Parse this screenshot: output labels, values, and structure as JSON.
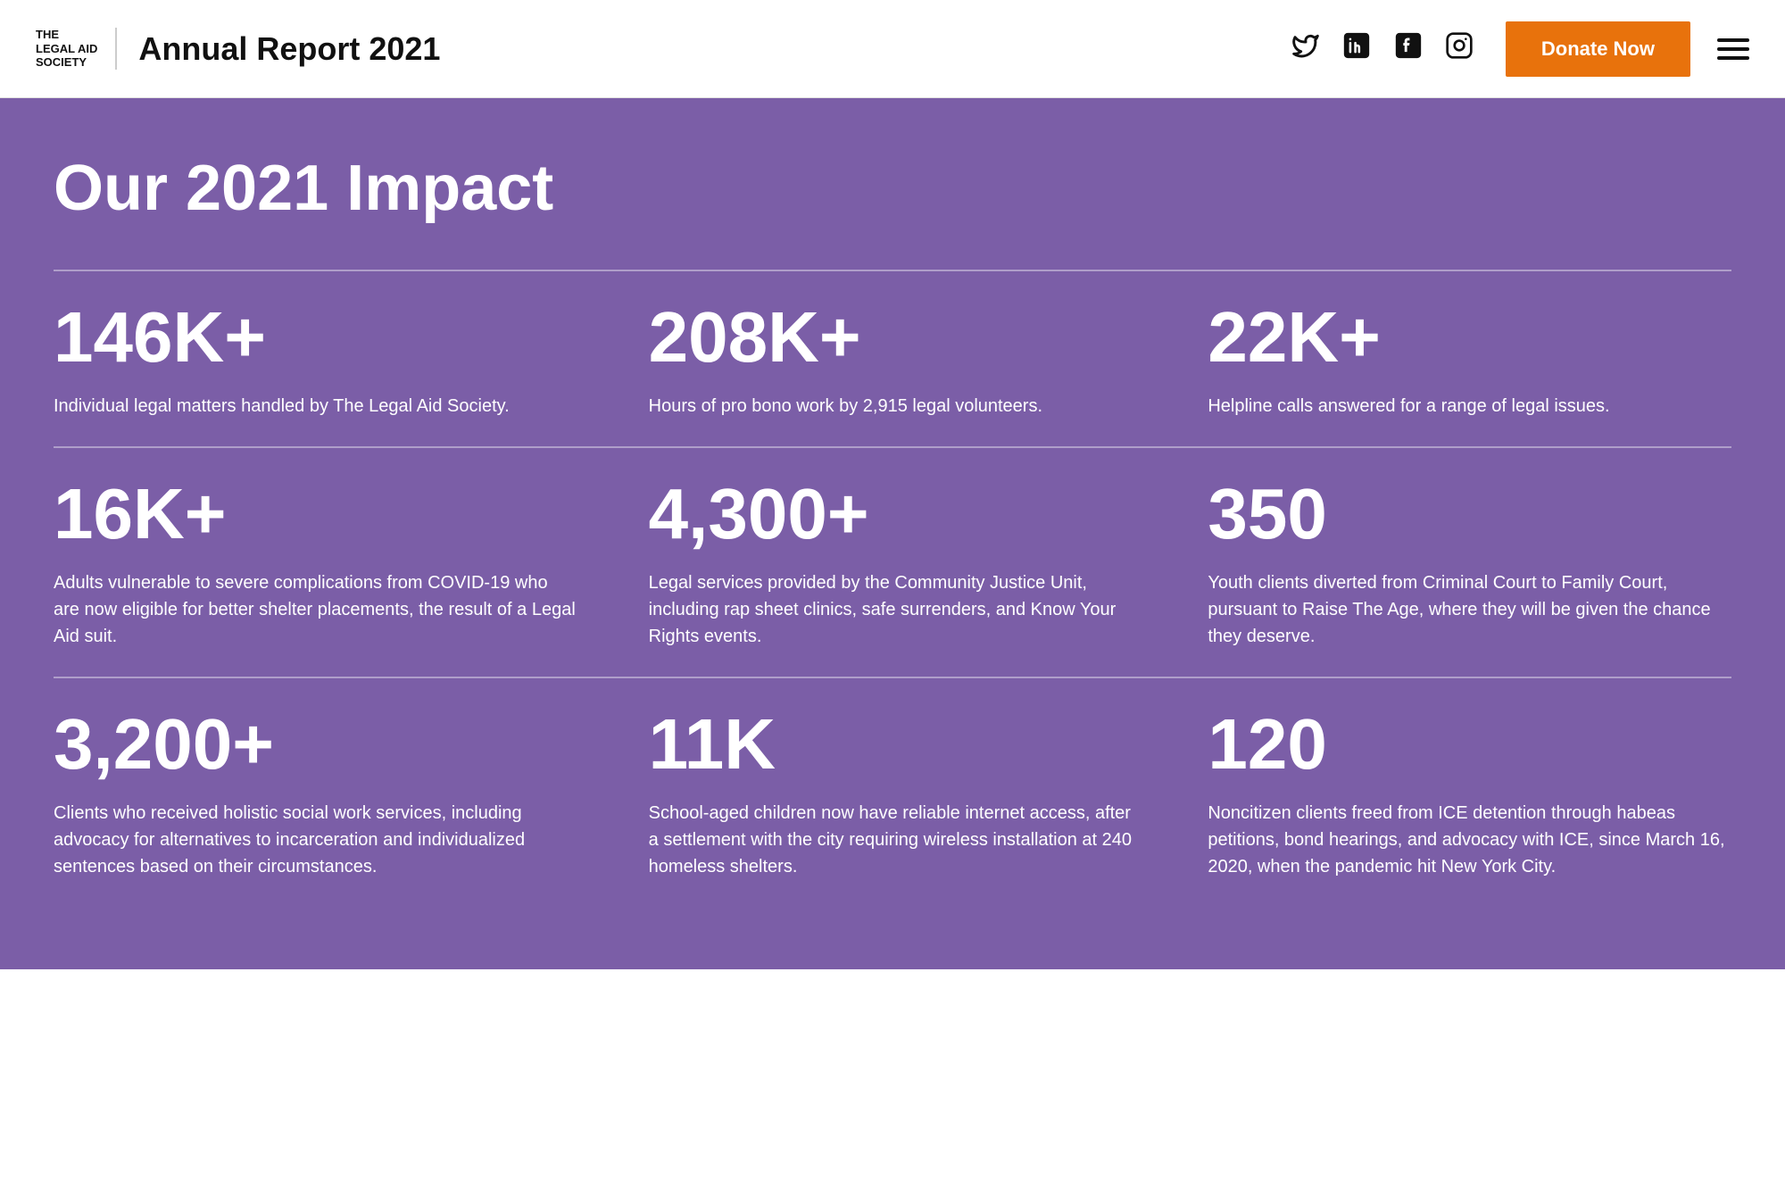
{
  "header": {
    "logo_line1": "THE\nLEGAL AID\nSOCIETY",
    "report_title": "Annual Report 2021",
    "donate_label": "Donate Now"
  },
  "social": {
    "twitter_label": "Twitter",
    "linkedin_label": "LinkedIn",
    "facebook_label": "Facebook",
    "instagram_label": "Instagram"
  },
  "impact": {
    "section_title": "Our 2021 Impact",
    "stats": [
      {
        "number": "146K+",
        "description": "Individual legal matters handled by The Legal Aid Society."
      },
      {
        "number": "208K+",
        "description": "Hours of pro bono work by 2,915 legal volunteers."
      },
      {
        "number": "22K+",
        "description": "Helpline calls answered for a range of legal issues."
      },
      {
        "number": "16K+",
        "description": "Adults vulnerable to severe complications from COVID-19 who are now eligible for better shelter placements, the result of a Legal Aid suit."
      },
      {
        "number": "4,300+",
        "description": "Legal services provided by the Community Justice Unit, including rap sheet clinics, safe surrenders, and Know Your Rights events."
      },
      {
        "number": "350",
        "description": "Youth clients diverted from Criminal Court to Family Court, pursuant to Raise The Age, where they will be given the chance they deserve."
      },
      {
        "number": "3,200+",
        "description": "Clients who received holistic social work services, including advocacy for alternatives to incarceration and individualized sentences based on their circumstances."
      },
      {
        "number": "11K",
        "description": "School-aged children now have reliable internet access, after a settlement with the city requiring wireless installation at 240 homeless shelters."
      },
      {
        "number": "120",
        "description": "Noncitizen clients freed from ICE detention through habeas petitions, bond hearings, and advocacy with ICE, since March 16, 2020, when the pandemic hit New York City."
      }
    ]
  }
}
